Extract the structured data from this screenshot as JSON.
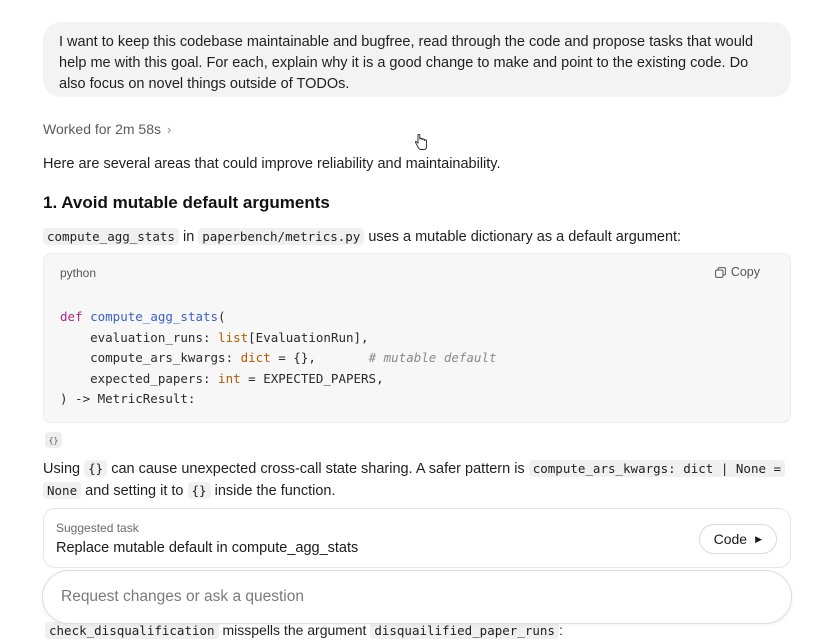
{
  "user_message": "I want to keep this codebase maintainable and bugfree, read through the code and propose tasks that would help me with this goal. For each, explain why it is a good change to make and point to the existing code. Do also focus on novel things outside of TODOs.",
  "worked": {
    "label": "Worked for 2m 58s",
    "chevron": "›"
  },
  "intro": "Here are several areas that could improve reliability and maintainability.",
  "section1": {
    "heading": "1. Avoid mutable default arguments",
    "desc_code1": "compute_agg_stats",
    "desc_text1": " in ",
    "desc_code2": "paperbench/metrics.py",
    "desc_text2": " uses a mutable dictionary as a default argument:"
  },
  "code_block": {
    "language": "python",
    "copy_label": "Copy",
    "copy_icon": "copy-icon",
    "line1_kw": "def",
    "line1_fn": "compute_agg_stats",
    "line1_rest": "(",
    "line2_name": "    evaluation_runs: ",
    "line2_type": "list",
    "line2_rest": "[EvaluationRun],",
    "line3_name": "    compute_ars_kwargs: ",
    "line3_type": "dict",
    "line3_rest": " = {},",
    "line3_comment": "       # mutable default",
    "line4_name": "    expected_papers: ",
    "line4_type": "int",
    "line4_rest": " = EXPECTED_PAPERS,",
    "line5": ") -> MetricResult:"
  },
  "braces_chip": "{}",
  "explanation": {
    "t1": "Using ",
    "c1": "{}",
    "t2": " can cause unexpected cross-call state sharing. A safer pattern is ",
    "c2": "compute_ars_kwargs: dict | None =",
    "c3": "None",
    "t3": " and setting it to ",
    "c4": "{}",
    "t4": " inside the function."
  },
  "task": {
    "caption": "Suggested task",
    "title": "Replace mutable default in compute_agg_stats",
    "button_label": "Code",
    "button_icon": "▶"
  },
  "composer": {
    "placeholder": "Request changes or ask a question"
  },
  "next_line": {
    "c1": "check_disqualification",
    "t1": " misspells the argument ",
    "c2": "disquailified_paper_runs",
    "t2": ":"
  }
}
